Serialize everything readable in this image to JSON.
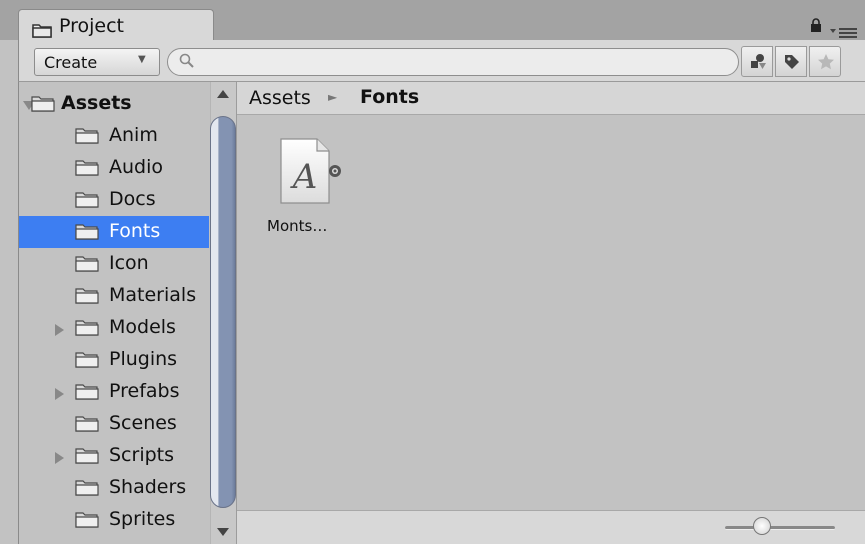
{
  "window": {
    "tab_title": "Project",
    "tab_icon": "folder-icon",
    "lock_icon": "lock-icon",
    "menu_icon": "context-menu-icon"
  },
  "toolbar": {
    "create_label": "Create",
    "create_arrow": "▼",
    "search_value": "",
    "search_icon": "search-icon",
    "filter_type_icon": "filter-by-type-icon",
    "filter_label_icon": "filter-by-label-icon",
    "favorite_icon": "star-icon"
  },
  "tree": {
    "items": [
      {
        "label": "Assets",
        "state": "expanded",
        "level": 0,
        "selected": false
      },
      {
        "label": "Anim",
        "state": "leaf",
        "level": 1,
        "selected": false
      },
      {
        "label": "Audio",
        "state": "leaf",
        "level": 1,
        "selected": false
      },
      {
        "label": "Docs",
        "state": "leaf",
        "level": 1,
        "selected": false
      },
      {
        "label": "Fonts",
        "state": "leaf",
        "level": 1,
        "selected": true
      },
      {
        "label": "Icon",
        "state": "leaf",
        "level": 1,
        "selected": false
      },
      {
        "label": "Materials",
        "state": "leaf",
        "level": 1,
        "selected": false
      },
      {
        "label": "Models",
        "state": "collapsed",
        "level": 1,
        "selected": false
      },
      {
        "label": "Plugins",
        "state": "leaf",
        "level": 1,
        "selected": false
      },
      {
        "label": "Prefabs",
        "state": "collapsed",
        "level": 1,
        "selected": false
      },
      {
        "label": "Scenes",
        "state": "leaf",
        "level": 1,
        "selected": false
      },
      {
        "label": "Scripts",
        "state": "collapsed",
        "level": 1,
        "selected": false
      },
      {
        "label": "Shaders",
        "state": "leaf",
        "level": 1,
        "selected": false
      },
      {
        "label": "Sprites",
        "state": "leaf",
        "level": 1,
        "selected": false
      }
    ]
  },
  "breadcrumb": {
    "root": "Assets",
    "separator": "►",
    "current": "Fonts"
  },
  "assets": [
    {
      "name": "Monts…",
      "icon": "font-file-icon",
      "glyph": "A"
    }
  ],
  "footer": {
    "zoom_fraction": 0.34
  },
  "colors": {
    "selection": "#3d7ef2",
    "panel": "#c2c2c2",
    "scroll_thumb": "#8393b2"
  }
}
